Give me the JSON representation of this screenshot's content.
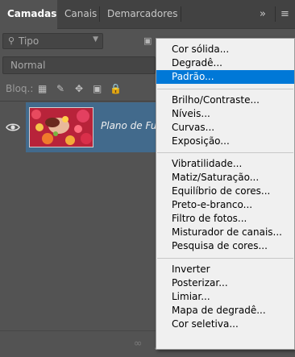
{
  "tabs": [
    {
      "label": "Camadas",
      "active": true
    },
    {
      "label": "Canais",
      "active": false
    },
    {
      "label": "Demarcadores",
      "active": false
    }
  ],
  "tabbar_icons": {
    "collapse": "double-chevron-right-icon",
    "menu": "hamburger-menu-icon"
  },
  "filter": {
    "placeholder": "Tipo",
    "icon": "search-icon"
  },
  "blend_mode": "Normal",
  "lock": {
    "label": "Bloq.:"
  },
  "layer": {
    "name": "Plano de Fu",
    "visible": true
  },
  "menu": {
    "highlighted": "Padrão...",
    "groups": [
      [
        "Cor sólida...",
        "Degradê...",
        "Padrão..."
      ],
      [
        "Brilho/Contraste...",
        "Níveis...",
        "Curvas...",
        "Exposição..."
      ],
      [
        "Vibratilidade...",
        "Matiz/Saturação...",
        "Equilíbrio de cores...",
        "Preto-e-branco...",
        "Filtro de fotos...",
        "Misturador de canais...",
        "Pesquisa de cores..."
      ],
      [
        "Inverter",
        "Posterizar...",
        "Limiar...",
        "Mapa de degradê...",
        "Cor seletiva..."
      ]
    ]
  },
  "colors": {
    "panel_bg": "#535353",
    "tabbar_bg": "#424242",
    "layer_selected": "#426a8c",
    "menu_bg": "#f0f0f0",
    "menu_highlight": "#0078d7"
  }
}
